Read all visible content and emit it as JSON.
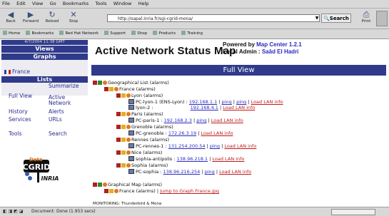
{
  "menu": [
    "File",
    "Edit",
    "View",
    "Go",
    "Bookmarks",
    "Tools",
    "Window",
    "Help"
  ],
  "nav": {
    "back": "Back",
    "forward": "Forward",
    "reload": "Reload",
    "stop": "Stop",
    "url": "http://sapal.inria.fr/sgi-cgrid-mona/",
    "search": "Search",
    "print": "Print"
  },
  "bookmarks": [
    "Home",
    "Bookmarks",
    "Red Hat Network",
    "Support",
    "Shop",
    "Products",
    "Training"
  ],
  "sidebar": {
    "last_update": "4/7/2004 11:38 GMT",
    "views_label": "Views",
    "graphs_label": "Graphs",
    "graphs_item": "France",
    "lists_label": "Lists",
    "full_view": "Full View",
    "summarize": "Summarize",
    "active_network": "Active Network",
    "history": "History",
    "alerts": "Alerts",
    "services": "Services",
    "urls": "URLs",
    "tools": "Tools",
    "search": "Search",
    "logo1": "CGRID",
    "logo2": "INRIA"
  },
  "main": {
    "title": "Active Network Status Map",
    "powered_prefix": "Powered by",
    "powered_link": "Map Center 1.2.1",
    "admin_prefix": "Local Admin :",
    "admin_name": "Saâd El Hadri",
    "section": "Full View"
  },
  "tree": {
    "root": "Geographical List (alarms)",
    "france": "France (alarms)",
    "lyon": "Lyon (alarms)",
    "lyon_host1": "PC-lyon-1 (ENS-Lyon) :",
    "lyon_host1_links": [
      "192.168.1.1",
      "ping",
      "ping",
      "Load LAN info"
    ],
    "lyon_host2": "lyon-2 :",
    "lyon_host2_links": [
      "192.168.4.1",
      "Load LAN info"
    ],
    "paris": "Paris (alarms)",
    "paris_host": "PC-paris-1 :",
    "paris_links": [
      "192.168.2.3",
      "ping",
      "Load LAN info"
    ],
    "grenoble": "Grenoble (alarms)",
    "grenoble_host": "PC-grenoble :",
    "grenoble_links": [
      "172.26.3.19",
      "Load LAN info"
    ],
    "rennes": "Rennes (alarms)",
    "rennes_host": "PC-rennes-1 :",
    "rennes_links": [
      "131.254.200.54",
      "ping",
      "Load LAN info"
    ],
    "nice": "Nice (alarms)",
    "nice_host": "sophia-antipolis :",
    "nice_links": [
      "138.96.218.1",
      "Load LAN info"
    ],
    "sophia": "Sophia (alarms)",
    "sophia_host": "PC-sophia :",
    "sophia_links": [
      "138.96.216.254",
      "ping",
      "Load LAN info"
    ],
    "graphs_map": "Graphical Map (alarms)",
    "france_map": "France (alarms)",
    "france_map_link": "Jump to Graph France.jpg",
    "footer_note": "MONITORING: Thunderbird & Mona"
  },
  "status": {
    "text": "Document: Done (1.953 secs)"
  }
}
